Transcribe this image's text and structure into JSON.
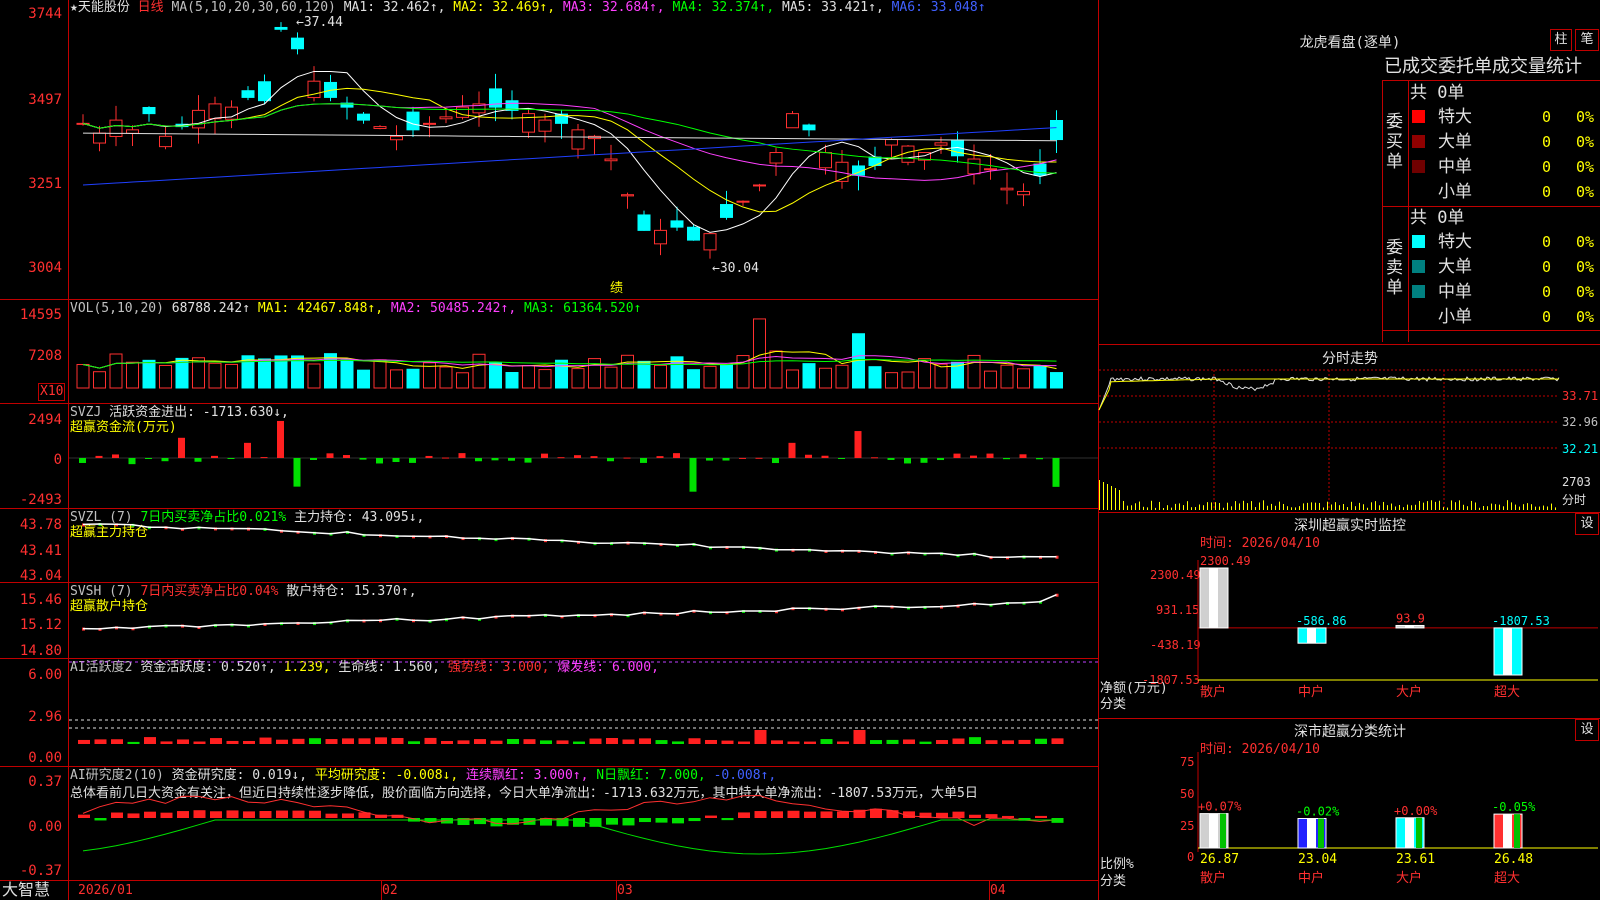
{
  "stock": {
    "name": "天能股份",
    "period": "日线",
    "ma_label": "MA(5,10,20,30,60,120)",
    "ma1": "MA1: 32.462↑,",
    "ma2": "MA2: 32.469↑,",
    "ma3": "MA3: 32.684↑,",
    "ma4": "MA4: 32.374↑,",
    "ma5": "MA5: 33.421↑,",
    "ma6": "MA6: 33.048↑",
    "high_marker": "37.44",
    "low_marker": "30.04",
    "event_marker": "绩",
    "y_labels": [
      "3744",
      "3497",
      "3251",
      "3004"
    ]
  },
  "vol": {
    "label": "VOL(5,10,20)",
    "value": "68788.242↑",
    "ma1": "MA1: 42467.848↑,",
    "ma2": "MA2: 50485.242↑,",
    "ma3": "MA3: 61364.520↑",
    "y_labels": [
      "14595",
      "7208"
    ],
    "unit": "X10"
  },
  "svzj": {
    "label": "SVZJ",
    "line1": "活跃资金进出: -1713.630↓,",
    "line2": "超赢资金流(万元)",
    "y_labels": [
      "2494",
      "0",
      "-2493"
    ]
  },
  "svzl": {
    "label": "SVZL (7)",
    "pct": "7日内买卖净占比0.021%",
    "hold": "主力持仓: 43.095↓,",
    "line2": "超赢主力持仓",
    "y_labels": [
      "43.78",
      "43.41",
      "43.04"
    ]
  },
  "svsh": {
    "label": "SVSH (7)",
    "pct": "7日内买卖净占比0.04%",
    "hold": "散户持仓: 15.370↑,",
    "line2": "超赢散户持仓",
    "y_labels": [
      "15.46",
      "15.12",
      "14.80"
    ]
  },
  "ai1": {
    "label": "AI活跃度2",
    "a": "资金活跃度: 0.520↑,",
    "b": "1.239,",
    "c": "生命线: 1.560,",
    "d": "强势线: 3.000,",
    "e": "爆发线: 6.000,",
    "y_labels": [
      "6.00",
      "2.96",
      "0.00"
    ]
  },
  "ai2": {
    "label": "AI研究度2(10)",
    "a": "资金研究度: 0.019↓,",
    "b": "平均研究度: -0.008↓,",
    "c": "连续飘红: 3.000↑,",
    "d": "N日飘红: 7.000,",
    "e": "-0.008↑,",
    "comment": "总体看前几日大资金有关注，但近日持续性逐步降低，股价面临方向选择，今日大单净流出：-1713.632万元，其中特大单净流出：-1807.53万元，大单5日",
    "y_labels": [
      "0.37",
      "0.00",
      "-0.37"
    ]
  },
  "xaxis": {
    "labels": [
      "2026/01",
      "02",
      "03",
      "04"
    ]
  },
  "brand": "大智慧",
  "dragon": {
    "title": "龙虎看盘(逐单)",
    "btn1": "柱",
    "btn2": "笔",
    "tabs": "已成交委托单成交量统计",
    "buy": {
      "side": "委买单",
      "total": "共 0单",
      "rows": [
        {
          "label": "特大",
          "count": "0",
          "pct": "0%"
        },
        {
          "label": "大单",
          "count": "0",
          "pct": "0%"
        },
        {
          "label": "中单",
          "count": "0",
          "pct": "0%"
        },
        {
          "label": "小单",
          "count": "0",
          "pct": "0%"
        }
      ]
    },
    "sell": {
      "side": "委卖单",
      "total": "共 0单",
      "rows": [
        {
          "label": "特大",
          "count": "0",
          "pct": "0%"
        },
        {
          "label": "大单",
          "count": "0",
          "pct": "0%"
        },
        {
          "label": "中单",
          "count": "0",
          "pct": "0%"
        },
        {
          "label": "小单",
          "count": "0",
          "pct": "0%"
        }
      ]
    }
  },
  "intraday": {
    "title": "分时走势",
    "y_labels": [
      "33.71",
      "32.96",
      "32.21"
    ],
    "vol_label": "2703",
    "vol_unit": "分时"
  },
  "monitor": {
    "title": "深圳超赢实时监控",
    "btn": "设",
    "time": "时间: 2026/04/10",
    "y_labels": [
      "2300.49",
      "931.15",
      "-438.19",
      "-1807.53"
    ],
    "axis_title": "净额(万元)",
    "axis_sub": "分类",
    "bars": [
      {
        "cat": "散户",
        "value": 2300.49,
        "label": "2300.49"
      },
      {
        "cat": "中户",
        "value": -586.86,
        "label": "-586.86"
      },
      {
        "cat": "大户",
        "value": 93.9,
        "label": "93.9"
      },
      {
        "cat": "超大",
        "value": -1807.53,
        "label": "-1807.53"
      }
    ]
  },
  "classify": {
    "title": "深市超赢分类统计",
    "btn": "设",
    "time": "时间: 2026/04/10",
    "y_labels": [
      "75",
      "50",
      "25",
      "0"
    ],
    "axis_title": "比例%",
    "axis_sub": "分类",
    "bars": [
      {
        "cat": "散户",
        "value": 26.87,
        "change": "+0.07%"
      },
      {
        "cat": "中户",
        "value": 23.04,
        "change": "-0.02%"
      },
      {
        "cat": "大户",
        "value": 23.61,
        "change": "+0.00%"
      },
      {
        "cat": "超大",
        "value": 26.48,
        "change": "-0.05%"
      }
    ]
  },
  "colors": {
    "up": "#ff3030",
    "down": "#00ffff",
    "grid": "#c00000",
    "text": "#c0c0c0"
  }
}
